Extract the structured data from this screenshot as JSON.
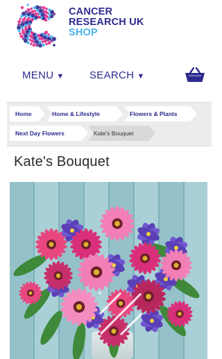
{
  "brand": {
    "line1": "CANCER",
    "line2": "RESEARCH UK",
    "line3": "SHOP",
    "primary_color": "#2d2a8f",
    "accent_color": "#4ab4ef",
    "logo_icon": "cancer-research-uk-c-logo"
  },
  "nav": {
    "menu_label": "MENU",
    "search_label": "SEARCH",
    "caret": "▼",
    "basket_icon": "basket-icon"
  },
  "breadcrumb": {
    "items": [
      {
        "label": "Home"
      },
      {
        "label": "Home & Lifestyle"
      },
      {
        "label": "Flowers & Plants"
      },
      {
        "label": "Next Day Flowers"
      },
      {
        "label": "Kate's Bouquet"
      }
    ]
  },
  "product": {
    "title": "Kate's Bouquet",
    "image_subject": "bouquet of pink gerberas, purple irises and gypsophila in a vase"
  }
}
